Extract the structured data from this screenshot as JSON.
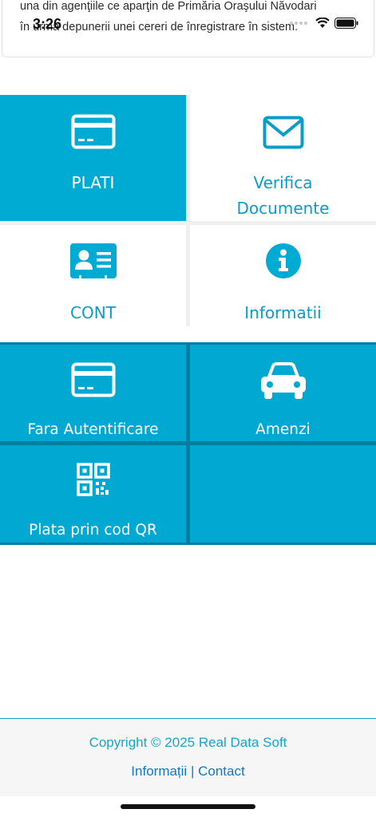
{
  "status_bar": {
    "time": "3:26"
  },
  "notice": {
    "line1": "una din agenţiile ce aparţin de Primăria Oraşului Năvodari",
    "line2": "în urma depunerii unei cereri de înregistrare în sistem."
  },
  "tiles": {
    "plati": "PLATI",
    "verifica": "Verifica Documente",
    "cont": "CONT",
    "informatii": "Informatii",
    "fara_autentificare": "Fara Autentificare",
    "amenzi": "Amenzi",
    "plata_qr": "Plata prin cod QR"
  },
  "footer": {
    "copyright": "Copyright © 2025 Real Data Soft",
    "link_info": "Informații",
    "separator": "|",
    "link_contact": "Contact"
  },
  "colors": {
    "primary": "#00abd3",
    "accent_text": "#0c9cc8",
    "link": "#1378c1"
  }
}
